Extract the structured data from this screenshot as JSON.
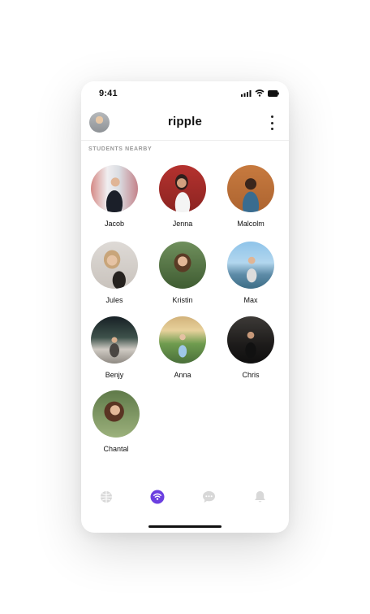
{
  "status_bar": {
    "time": "9:41",
    "icons": [
      "cellular-signal-icon",
      "wifi-icon",
      "battery-icon"
    ]
  },
  "header": {
    "title": "ripple",
    "avatar_icon": "profile-avatar",
    "menu_icon": "kebab-menu-icon"
  },
  "section": {
    "label": "STUDENTS NEARBY"
  },
  "students": [
    {
      "name": "Jacob"
    },
    {
      "name": "Jenna"
    },
    {
      "name": "Malcolm"
    },
    {
      "name": "Jules"
    },
    {
      "name": "Kristin"
    },
    {
      "name": "Max"
    },
    {
      "name": "Benjy"
    },
    {
      "name": "Anna"
    },
    {
      "name": "Chris"
    },
    {
      "name": "Chantal"
    }
  ],
  "tab_bar": {
    "tabs": [
      {
        "icon": "globe-icon",
        "active": false
      },
      {
        "icon": "radar-icon",
        "active": true
      },
      {
        "icon": "chat-icon",
        "active": false
      },
      {
        "icon": "bell-icon",
        "active": false
      }
    ],
    "active_color": "#6B3FE0",
    "inactive_color": "#D6D6D6"
  }
}
